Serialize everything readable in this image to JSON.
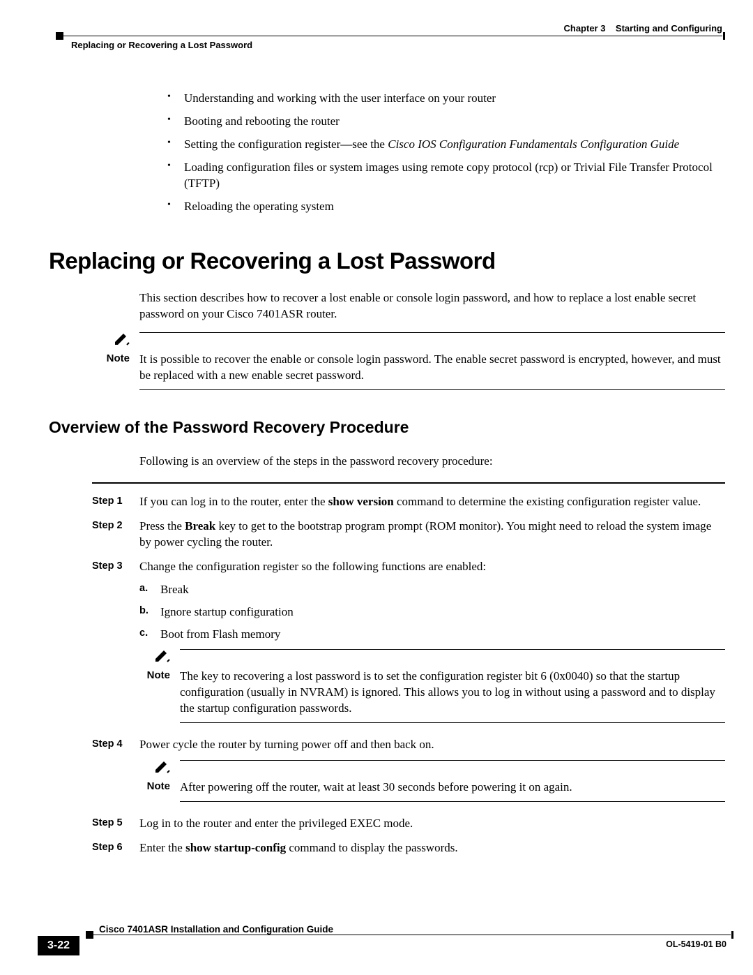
{
  "header": {
    "chapter_label": "Chapter 3",
    "chapter_title": "Starting and Configuring",
    "section_breadcrumb": "Replacing or Recovering a Lost Password"
  },
  "top_bullets": {
    "b1": "Understanding and working with the user interface on your router",
    "b2": "Booting and rebooting the router",
    "b3_pre": "Setting the configuration register—see the ",
    "b3_italic": "Cisco IOS Configuration Fundamentals Configuration Guide",
    "b4": "Loading configuration files or system images using remote copy protocol (rcp) or Trivial File Transfer Protocol (TFTP)",
    "b5": "Reloading the operating system"
  },
  "h1": "Replacing or Recovering a Lost Password",
  "intro_para": "This section describes how to recover a lost enable or console login password, and how to replace a lost enable secret password on your Cisco 7401ASR router.",
  "note1": {
    "label": "Note",
    "text": "It is possible to recover the enable or console login password. The enable secret password is encrypted, however, and must be replaced with a new enable secret password."
  },
  "h2": "Overview of the Password Recovery Procedure",
  "overview_para": "Following is an overview of the steps in the password recovery procedure:",
  "steps": {
    "s1_label": "Step 1",
    "s1_pre": "If you can log in to the router, enter the ",
    "s1_bold": "show version",
    "s1_post": " command to determine the existing configuration register value.",
    "s2_label": "Step 2",
    "s2_pre": "Press the ",
    "s2_bold": "Break",
    "s2_post": " key to get to the bootstrap program prompt (ROM monitor). You might need to reload the system image by power cycling the router.",
    "s3_label": "Step 3",
    "s3_text": "Change the configuration register so the following functions are enabled:",
    "s3a_letter": "a.",
    "s3a_text": "Break",
    "s3b_letter": "b.",
    "s3b_text": "Ignore startup configuration",
    "s3c_letter": "c.",
    "s3c_text": "Boot from Flash memory",
    "s3_note_label": "Note",
    "s3_note_text": "The key to recovering a lost password is to set the configuration register bit 6 (0x0040) so that the startup configuration (usually in NVRAM) is ignored. This allows you to log in without using a password and to display the startup configuration passwords.",
    "s4_label": "Step 4",
    "s4_text": "Power cycle the router by turning power off and then back on.",
    "s4_note_label": "Note",
    "s4_note_text": "After powering off the router, wait at least 30 seconds before powering it on again.",
    "s5_label": "Step 5",
    "s5_text": "Log in to the router and enter the privileged EXEC mode.",
    "s6_label": "Step 6",
    "s6_pre": "Enter the ",
    "s6_bold": "show startup-config",
    "s6_post": " command to display the passwords."
  },
  "footer": {
    "guide_title": "Cisco 7401ASR Installation and Configuration Guide",
    "page_number": "3-22",
    "doc_id": "OL-5419-01 B0"
  }
}
